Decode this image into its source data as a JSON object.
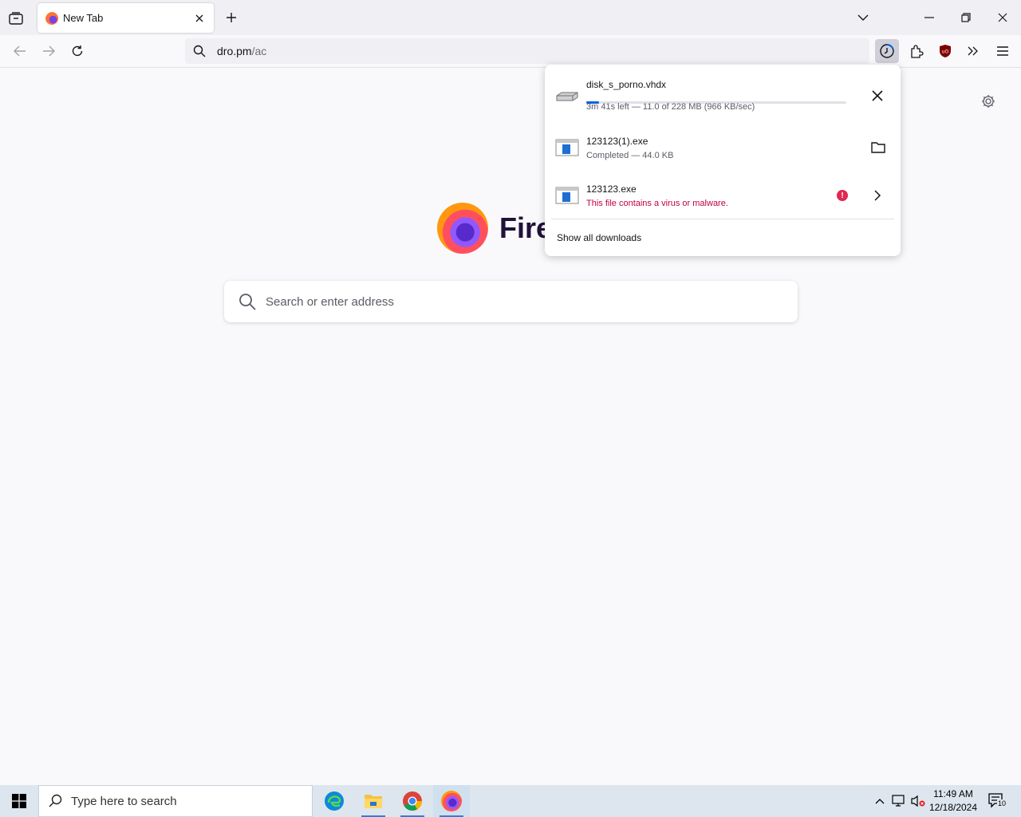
{
  "browser": {
    "tab": {
      "title": "New Tab"
    },
    "url": {
      "host": "dro.pm",
      "path": "/ac"
    }
  },
  "newtab": {
    "logo_text": "Fire",
    "search_placeholder": "Search or enter address"
  },
  "downloads": {
    "items": [
      {
        "name": "disk_s_porno.vhdx",
        "status": "3m 41s left — 11.0 of 228 MB (966 KB/sec)",
        "progress": 0.048,
        "action": "close-icon"
      },
      {
        "name": "123123(1).exe",
        "status": "Completed — 44.0 KB",
        "action": "folder-icon"
      },
      {
        "name": "123123.exe",
        "status": "This file contains a virus or malware.",
        "status_type": "danger",
        "warning_glyph": "!",
        "action": "chevron-right-icon"
      }
    ],
    "show_all": "Show all downloads"
  },
  "taskbar": {
    "search_placeholder": "Type here to search",
    "time": "11:49 AM",
    "date": "12/18/2024",
    "notification_count": "10",
    "apps": [
      "edge-icon",
      "file-explorer-icon",
      "chrome-icon",
      "firefox-icon"
    ]
  },
  "colors": {
    "accent": "#0061e0",
    "danger": "#c50042",
    "tabstrip": "#f0f0f4",
    "taskbar": "#dde6ee"
  }
}
